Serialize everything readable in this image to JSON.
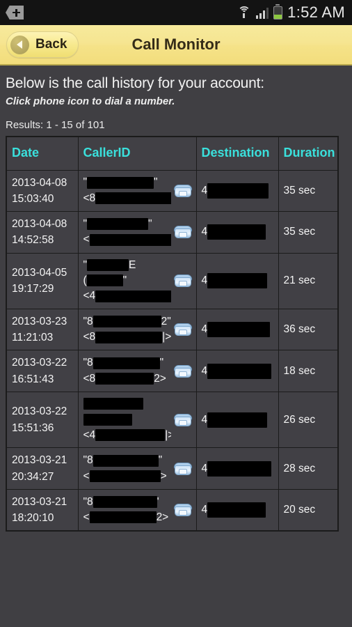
{
  "status_bar": {
    "left_icon": "tag-plus-icon",
    "wifi_icon": "wifi-icon",
    "signal_icon": "signal-bars-icon",
    "battery_icon": "battery-icon",
    "clock": "1:52 AM"
  },
  "title_bar": {
    "back_label": "Back",
    "back_icon": "chevron-left-icon",
    "title": "Call Monitor"
  },
  "content": {
    "heading": "Below is the call history for your account:",
    "subheading": "Click phone icon to dial a number.",
    "results": "Results: 1 - 15 of 101"
  },
  "table": {
    "columns": [
      "Date",
      "CallerID",
      "Destination",
      "Duration"
    ],
    "rows": [
      {
        "date": "2013-04-08",
        "time": "15:03:40",
        "caller_lines": [
          {
            "prefix": "\"",
            "redacted_width": 96,
            "suffix": "\""
          },
          {
            "prefix": "<8",
            "redacted_width": 126,
            "suffix": ">"
          }
        ],
        "phone_icon": "phone-dial-icon",
        "destination_prefix": "4",
        "destination_redacted_width": 88,
        "duration": "35 sec"
      },
      {
        "date": "2013-04-08",
        "time": "14:52:58",
        "caller_lines": [
          {
            "prefix": "\"",
            "redacted_width": 88,
            "suffix": "\""
          },
          {
            "prefix": "<",
            "redacted_width": 120,
            "suffix": "|>"
          }
        ],
        "phone_icon": "phone-dial-icon",
        "destination_prefix": "4",
        "destination_redacted_width": 84,
        "duration": "35 sec"
      },
      {
        "date": "2013-04-05",
        "time": "19:17:29",
        "caller_lines": [
          {
            "prefix": "\"",
            "redacted_width": 60,
            "suffix": "E"
          },
          {
            "prefix": "(",
            "redacted_width": 52,
            "suffix": "\""
          },
          {
            "prefix": "<4",
            "redacted_width": 110,
            "suffix": ">"
          }
        ],
        "phone_icon": "phone-dial-icon",
        "destination_prefix": "4",
        "destination_redacted_width": 86,
        "duration": "21 sec"
      },
      {
        "date": "2013-03-23",
        "time": "11:21:03",
        "caller_lines": [
          {
            "prefix": "\"8",
            "redacted_width": 98,
            "suffix": "2\""
          },
          {
            "prefix": "<8",
            "redacted_width": 96,
            "suffix": "|>"
          }
        ],
        "phone_icon": "phone-dial-icon",
        "destination_prefix": "4",
        "destination_redacted_width": 90,
        "duration": "36 sec"
      },
      {
        "date": "2013-03-22",
        "time": "16:51:43",
        "caller_lines": [
          {
            "prefix": "\"8",
            "redacted_width": 96,
            "suffix": "\""
          },
          {
            "prefix": "<8",
            "redacted_width": 84,
            "suffix": "2>"
          }
        ],
        "phone_icon": "phone-dial-icon",
        "destination_prefix": "4",
        "destination_redacted_width": 92,
        "duration": "18 sec"
      },
      {
        "date": "2013-03-22",
        "time": "15:51:36",
        "caller_lines": [
          {
            "prefix": "",
            "redacted_width": 86,
            "suffix": ""
          },
          {
            "prefix": "",
            "redacted_width": 70,
            "suffix": ""
          },
          {
            "prefix": "<4",
            "redacted_width": 100,
            "suffix": "|>"
          }
        ],
        "phone_icon": "phone-dial-icon",
        "destination_prefix": "4",
        "destination_redacted_width": 86,
        "duration": "26 sec"
      },
      {
        "date": "2013-03-21",
        "time": "20:34:27",
        "caller_lines": [
          {
            "prefix": "\"8",
            "redacted_width": 94,
            "suffix": "\""
          },
          {
            "prefix": "<",
            "redacted_width": 102,
            "suffix": ">"
          }
        ],
        "phone_icon": "phone-dial-icon",
        "destination_prefix": "4",
        "destination_redacted_width": 92,
        "duration": "28 sec"
      },
      {
        "date": "2013-03-21",
        "time": "18:20:10",
        "caller_lines": [
          {
            "prefix": "\"8",
            "redacted_width": 92,
            "suffix": "'"
          },
          {
            "prefix": "<",
            "redacted_width": 96,
            "suffix": "2>"
          }
        ],
        "phone_icon": "phone-dial-icon",
        "destination_prefix": "4",
        "destination_redacted_width": 84,
        "duration": "20 sec"
      }
    ]
  },
  "colors": {
    "page_background": "#403F43",
    "title_bar": "#f5e288",
    "header_text": "#3ae0dc",
    "status_bar": "#131313",
    "battery_level": "#8cc63f"
  }
}
